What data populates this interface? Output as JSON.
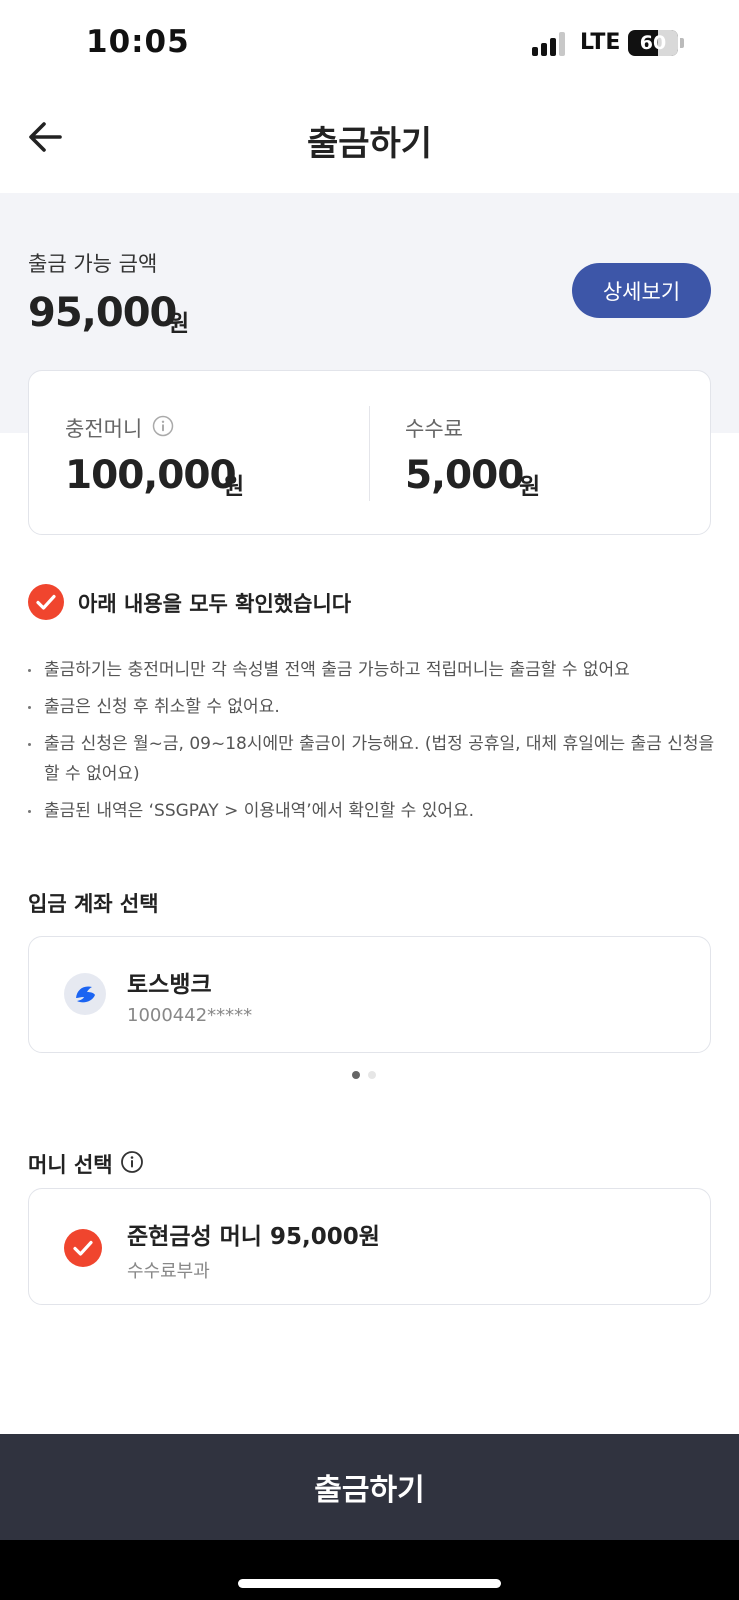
{
  "status_bar": {
    "time": "10:05",
    "network": "LTE",
    "battery": "60",
    "battery_level": 0.6
  },
  "header": {
    "title": "출금하기",
    "back_icon": "arrow-left-icon"
  },
  "summary": {
    "available_label": "출금 가능 금액",
    "available_amount": "95,000",
    "unit": "원",
    "detail_button": "상세보기"
  },
  "breakdown": {
    "charge_label": "충전머니",
    "charge_amount": "100,000",
    "charge_unit": "원",
    "fee_label": "수수료",
    "fee_amount": "5,000",
    "fee_unit": "원",
    "info_icon": "info-circle-icon"
  },
  "confirm": {
    "label": "아래 내용을 모두 확인했습니다",
    "checked": true,
    "accent_color": "#f0452e"
  },
  "notices": [
    "출금하기는 충전머니만 각 속성별 전액 출금 가능하고 적립머니는 출금할 수 없어요",
    "출금은 신청 후 취소할 수 없어요.",
    "출금 신청은 월~금, 09~18시에만 출금이 가능해요. (법정 공휴일, 대체 휴일에는 출금 신청을 할 수 없어요)",
    "출금된 내역은 ‘SSGPAY > 이용내역’에서 확인할 수 있어요."
  ],
  "account": {
    "title": "입금 계좌 선택",
    "bank_name": "토스뱅크",
    "account_number": "1000442*****",
    "bank_icon": "toss-bank-logo-icon",
    "brand_color": "#1b64f2",
    "pager_total": 2,
    "pager_active": 1
  },
  "money": {
    "title": "머니 선택",
    "name": "준현금성 머니 95,000원",
    "note": "수수료부과",
    "selected": true
  },
  "footer": {
    "withdraw_button": "출금하기",
    "button_color": "#30333f"
  },
  "colors": {
    "primary_button": "#3d56a8",
    "summary_background": "#f3f4f8"
  }
}
